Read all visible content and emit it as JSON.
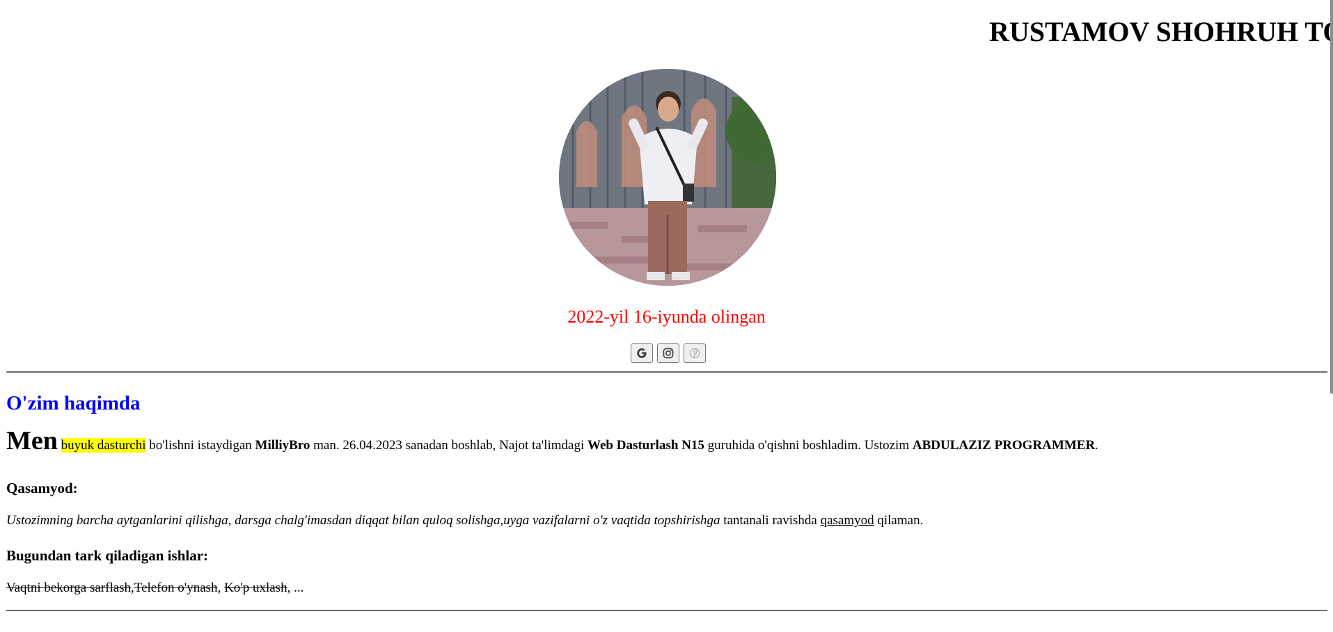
{
  "header": {
    "title": "RUSTAMOV SHOHRUH TOLIBOVICH"
  },
  "profile": {
    "caption": "2022-yil 16-iyunda olingan",
    "caption_color": "#ff0000"
  },
  "socials": [
    {
      "icon": "google-icon",
      "label": "G"
    },
    {
      "icon": "instagram-icon",
      "label": "Instagram"
    },
    {
      "icon": "pinterest-icon",
      "label": "Pinterest"
    }
  ],
  "about": {
    "heading": "O'zim haqimda",
    "heading_color": "#0000ff",
    "intro": {
      "lead": "Men",
      "highlight": "buyuk dasturchi",
      "t1": "bo'lishni istaydigan",
      "b1": "MilliyBro",
      "t2": "man. 26.04.2023 sanadan boshlab, Najot ta'limdagi",
      "b2": "Web Dasturlash N15",
      "t3": "guruhida o'qishni boshladim. Ustozim",
      "b3": "ABDULAZIZ PROGRAMMER",
      "t4": "."
    },
    "oath_heading": "Qasamyod:",
    "oath": {
      "italic": "Ustozimning barcha aytganlarini qilishga, darsga chalg'imasdan diqqat bilan quloq solishga,uyga vazifalarni o'z vaqtida topshirishga",
      "t1": "tantanali ravishda",
      "underlined": "qasamyod",
      "t2": "qilaman."
    },
    "quit_heading": "Bugundan tark qiladigan ishlar:",
    "quit_items": {
      "s1": "Vaqtni bekorga sarflash",
      "sep1": ",",
      "s2": "Telefon o'ynash",
      "sep2": ", ",
      "s3": "Ko'p uxlash",
      "tail": ", ..."
    }
  },
  "colors": {
    "highlight": "#ffff00",
    "rule": "#6b6b6b"
  }
}
